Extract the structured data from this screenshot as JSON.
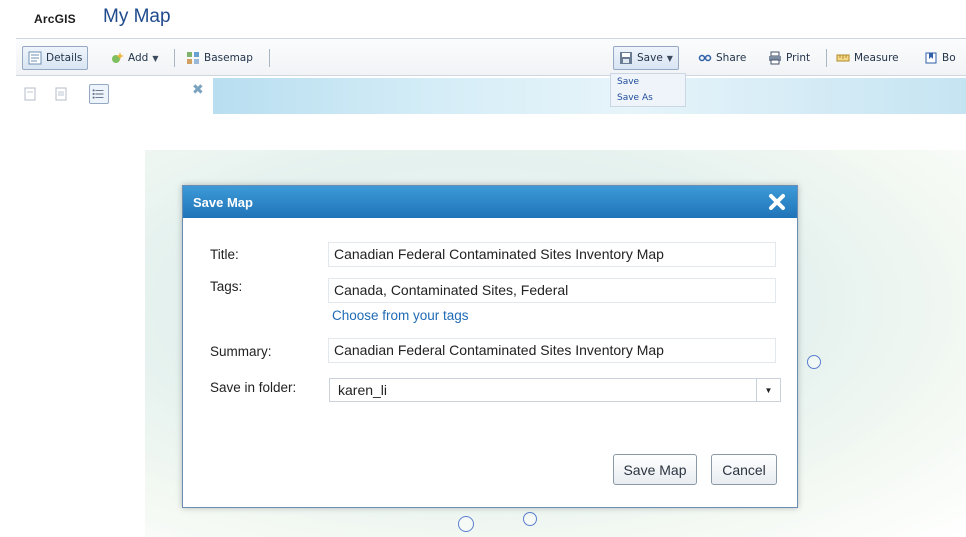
{
  "app": {
    "brand": "ArcGIS",
    "title": "My Map"
  },
  "toolbar": {
    "details_label": "Details",
    "add_label": "Add",
    "basemap_label": "Basemap",
    "save_label": "Save",
    "share_label": "Share",
    "print_label": "Print",
    "measure_label": "Measure",
    "bookmarks_label": "Bo"
  },
  "save_menu": {
    "items": [
      "Save",
      "Save As"
    ]
  },
  "dialog": {
    "title": "Save Map",
    "title_label": "Title:",
    "title_value": "Canadian Federal Contaminated Sites Inventory Map",
    "tags_label": "Tags:",
    "tags_value": "Canada, Contaminated Sites, Federal",
    "choose_tags_link": "Choose from your tags",
    "summary_label": "Summary:",
    "summary_value": "Canadian Federal Contaminated Sites Inventory Map",
    "folder_label": "Save in folder:",
    "folder_value": "karen_li",
    "save_button": "Save Map",
    "cancel_button": "Cancel"
  },
  "icons": {
    "details": "details-icon",
    "add": "add-icon",
    "basemap": "basemap-icon",
    "save": "save-icon",
    "share": "share-icon",
    "print": "print-icon",
    "measure": "measure-icon",
    "bookmarks": "bookmarks-icon",
    "close": "close-icon"
  },
  "colors": {
    "dialog_header": "#1f74b8",
    "link": "#1f6bb5",
    "title": "#1f4a8c"
  }
}
